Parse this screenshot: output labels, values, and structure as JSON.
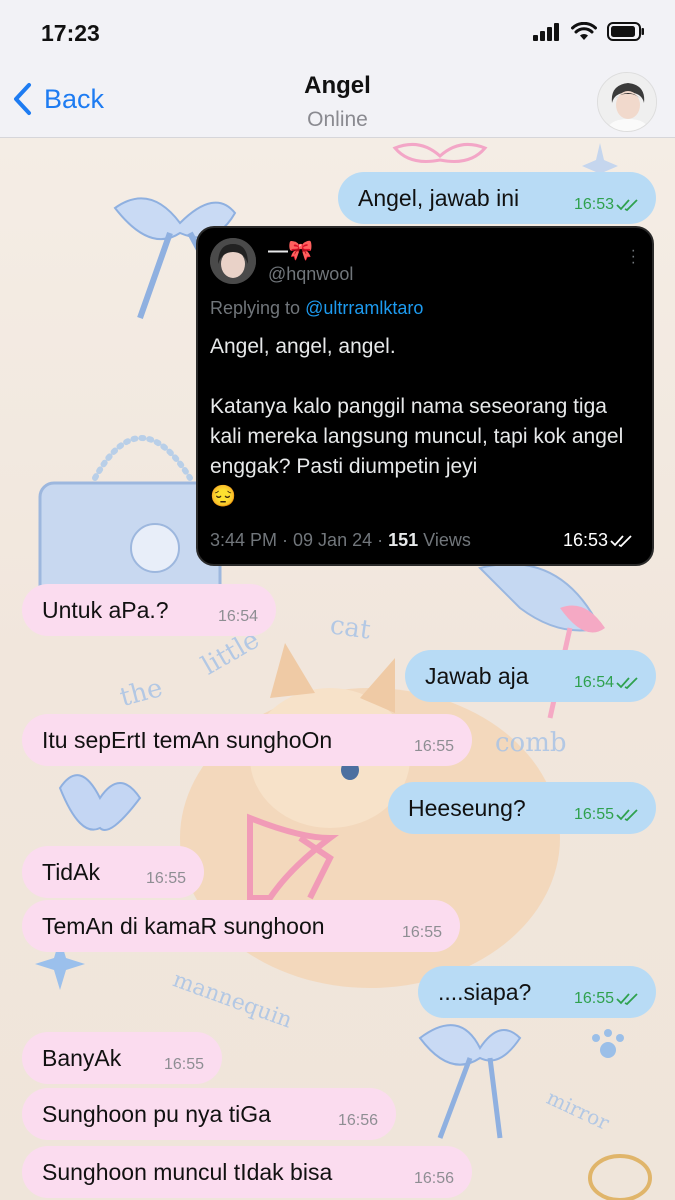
{
  "status": {
    "time": "17:23"
  },
  "header": {
    "back_label": "Back",
    "title": "Angel",
    "subtitle": "Online"
  },
  "tweet": {
    "name": "—🎀",
    "handle": "@hqnwool",
    "replying_prefix": "Replying to ",
    "replying_to": "@ultrramlktaro",
    "body": "Angel, angel, angel.\n\nKatanya kalo panggil nama seseorang tiga kali mereka langsung muncul, tapi kok angel enggak? Pasti diumpetin jeyi\n😔",
    "meta_prefix": "3:44 PM · 09 Jan 24 · ",
    "views_count": "151",
    "views_label": " Views",
    "message_time": "16:53"
  },
  "messages": [
    {
      "dir": "out",
      "text": "Angel, jawab ini",
      "time": "16:53"
    },
    {
      "dir": "in",
      "text": "Untuk aPa.?",
      "time": "16:54"
    },
    {
      "dir": "out",
      "text": "Jawab aja",
      "time": "16:54"
    },
    {
      "dir": "in",
      "text": "Itu sepErtI temAn sunghoOn",
      "time": "16:55"
    },
    {
      "dir": "out",
      "text": "Heeseung?",
      "time": "16:55"
    },
    {
      "dir": "in",
      "text": "TidAk",
      "time": "16:55"
    },
    {
      "dir": "in",
      "text": "TemAn di kamaR sunghoon",
      "time": "16:55"
    },
    {
      "dir": "out",
      "text": "....siapa?",
      "time": "16:55"
    },
    {
      "dir": "in",
      "text": "BanyAk",
      "time": "16:55"
    },
    {
      "dir": "in",
      "text": "Sunghoon pu nya tiGa",
      "time": "16:56"
    },
    {
      "dir": "in",
      "text": "Sunghoon muncul tIdak bisa",
      "time": "16:56"
    }
  ],
  "wallpaper_text": [
    "the",
    "little",
    "cat",
    "comb",
    "mannequin",
    "mirror"
  ],
  "colors": {
    "incoming": "#fbdcef",
    "outgoing": "#b8dbf5",
    "accent": "#1e7cf2",
    "read_ticks": "#2fa14e"
  }
}
